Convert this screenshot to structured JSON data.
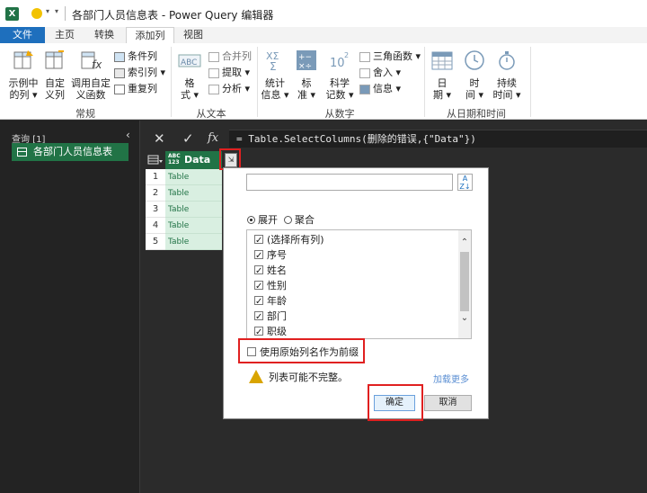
{
  "window": {
    "title": "各部门人员信息表 - Power Query 编辑器"
  },
  "tabs": [
    "文件",
    "主页",
    "转换",
    "添加列",
    "视图"
  ],
  "ribbon": {
    "groups": {
      "general": "常规",
      "from_text": "从文本",
      "from_number": "从数字",
      "from_date": "从日期和时间"
    },
    "buttons": {
      "example_col": [
        "示例中",
        "的列"
      ],
      "custom_col": [
        "自定",
        "义列"
      ],
      "invoke_func": [
        "调用自定",
        "义函数"
      ],
      "cond_col": "条件列",
      "index_col": "索引列",
      "dup_col": "重复列",
      "format": [
        "格",
        "式"
      ],
      "merge_col": "合并列",
      "extract": "提取",
      "parse": "分析",
      "stats": [
        "统计",
        "信息"
      ],
      "standard": [
        "标",
        "准"
      ],
      "scientific": [
        "科学",
        "记数"
      ],
      "trig": "三角函数",
      "rounding": "舍入",
      "info": "信息",
      "date": [
        "日",
        "期"
      ],
      "time": [
        "时",
        "间"
      ],
      "duration": [
        "持续",
        "时间"
      ]
    }
  },
  "queries": {
    "header": "查询 [1]",
    "items": [
      "各部门人员信息表"
    ]
  },
  "formula": {
    "cancel": "✕",
    "confirm": "✓",
    "fx": "fx",
    "text": "= Table.SelectColumns(删除的错误,{\"Data\"})"
  },
  "grid": {
    "type_label": "ABC\n123",
    "column": "Data",
    "rows": [
      {
        "n": "1",
        "v": "Table"
      },
      {
        "n": "2",
        "v": "Table"
      },
      {
        "n": "3",
        "v": "Table"
      },
      {
        "n": "4",
        "v": "Table"
      },
      {
        "n": "5",
        "v": "Table"
      }
    ]
  },
  "popup": {
    "search_value": "",
    "radio_expand": "展开",
    "radio_aggregate": "聚合",
    "columns": [
      {
        "label": "(选择所有列)",
        "checked": true
      },
      {
        "label": "序号",
        "checked": true
      },
      {
        "label": "姓名",
        "checked": true
      },
      {
        "label": "性别",
        "checked": true
      },
      {
        "label": "年龄",
        "checked": true
      },
      {
        "label": "部门",
        "checked": true
      },
      {
        "label": "职级",
        "checked": true
      }
    ],
    "prefix_label": "使用原始列名作为前缀",
    "warning": "列表可能不完整。",
    "load_more": "加载更多",
    "ok": "确定",
    "cancel": "取消"
  },
  "colors": {
    "excel_green": "#217346",
    "file_tab_blue": "#1e6fbd",
    "highlight_red": "#e02020",
    "cell_green": "#d9efe1"
  }
}
